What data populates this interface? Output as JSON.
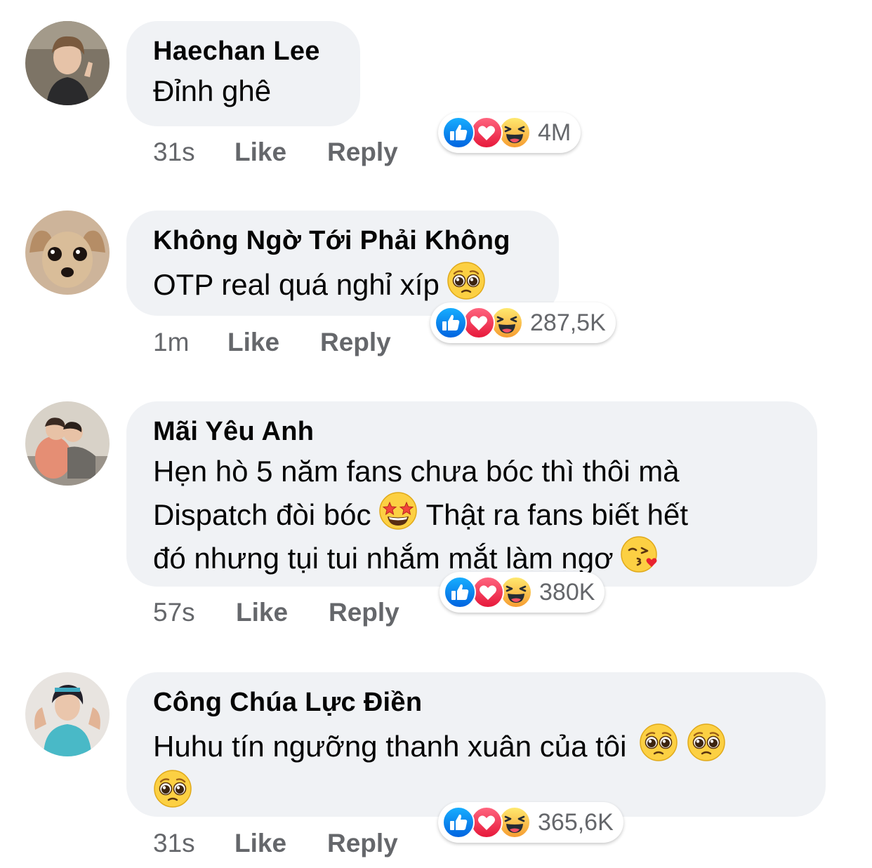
{
  "comments": [
    {
      "author": "Haechan Lee",
      "text_lines": [
        "Đỉnh ghê"
      ],
      "time": "31s",
      "like_label": "Like",
      "reply_label": "Reply",
      "reaction_count": "4M",
      "reactions": [
        "like-icon",
        "love-icon",
        "haha-icon"
      ]
    },
    {
      "author": "Không Ngờ Tới Phải Không",
      "text_lines": [
        "OTP real quá nghỉ xíp"
      ],
      "time": "1m",
      "like_label": "Like",
      "reply_label": "Reply",
      "reaction_count": "287,5K",
      "reactions": [
        "like-icon",
        "love-icon",
        "haha-icon"
      ]
    },
    {
      "author": "Mãi Yêu Anh",
      "text_lines": [
        "Hẹn hò 5 năm fans chưa bóc thì thôi mà",
        "Dispatch đòi bóc",
        "Thật ra fans biết hết",
        "đó nhưng tụi tui nhắm mắt làm ngơ"
      ],
      "time": "57s",
      "like_label": "Like",
      "reply_label": "Reply",
      "reaction_count": "380K",
      "reactions": [
        "like-icon",
        "love-icon",
        "haha-icon"
      ]
    },
    {
      "author": "Công Chúa Lực Điền",
      "text_lines": [
        "Huhu tín ngưỡng thanh xuân của tôi"
      ],
      "time": "31s",
      "like_label": "Like",
      "reply_label": "Reply",
      "reaction_count": "365,6K",
      "reactions": [
        "like-icon",
        "love-icon",
        "haha-icon"
      ]
    }
  ],
  "colors": {
    "bubble": "#f0f2f5",
    "secondary_text": "#65676b",
    "like_blue": "#1877f2",
    "love_red": "#f33e58",
    "haha_yellow": "#f7b125"
  }
}
